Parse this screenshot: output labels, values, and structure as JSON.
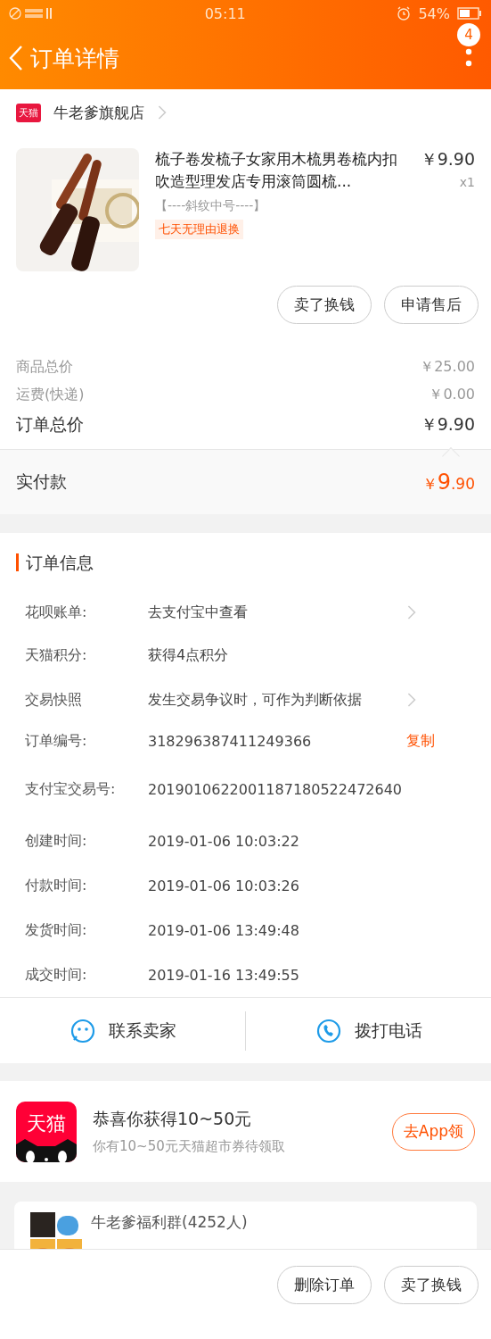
{
  "status_bar": {
    "time": "05:11",
    "battery": "54%"
  },
  "header": {
    "title": "订单详情",
    "badge": "4"
  },
  "store": {
    "badge": "天猫",
    "name": "牛老爹旗舰店"
  },
  "product": {
    "title": "梳子卷发梳子女家用木梳男卷梳内扣吹造型理发店专用滚筒圆梳...",
    "price": "￥9.90",
    "quantity": "x1",
    "variant": "【----斜纹中号----】",
    "tag": "七天无理由退换"
  },
  "product_actions": [
    "卖了换钱",
    "申请售后"
  ],
  "summary": [
    {
      "label": "商品总价",
      "value": "￥25.00",
      "kind": "minor"
    },
    {
      "label": "运费(快递)",
      "value": "￥0.00",
      "kind": "minor"
    },
    {
      "label": "订单总价",
      "value": "￥9.90",
      "kind": "total"
    }
  ],
  "paid": {
    "label": "实付款",
    "symbol": "￥",
    "integer": "9",
    "decimal": ".90"
  },
  "order_info": {
    "title": "订单信息",
    "rows": [
      {
        "label": "花呗账单:",
        "value": "去支付宝中查看",
        "kind": "link"
      },
      {
        "label": "天猫积分:",
        "value": "获得4点积分",
        "kind": "plain"
      },
      {
        "label": "交易快照",
        "value": "发生交易争议时，可作为判断依据",
        "kind": "link"
      },
      {
        "label": "订单编号:",
        "value": "318296387411249366",
        "kind": "copy",
        "action": "复制"
      },
      {
        "label": "支付宝交易号:",
        "value": "2019010622001187180522472640",
        "kind": "plain"
      },
      {
        "label": "创建时间:",
        "value": "2019-01-06 10:03:22",
        "kind": "plain"
      },
      {
        "label": "付款时间:",
        "value": "2019-01-06 10:03:26",
        "kind": "plain"
      },
      {
        "label": "发货时间:",
        "value": "2019-01-06 13:49:48",
        "kind": "plain"
      },
      {
        "label": "成交时间:",
        "value": "2019-01-16 13:49:55",
        "kind": "plain"
      }
    ]
  },
  "contact": [
    {
      "label": "联系卖家",
      "kind": "chat"
    },
    {
      "label": "拨打电话",
      "kind": "phone"
    }
  ],
  "promo": {
    "logo": "天猫",
    "title": "恭喜你获得10~50元",
    "subtitle": "你有10~50元天猫超市券待领取",
    "button": "去App领"
  },
  "group": {
    "name": "牛老爹福利群(4252人)"
  },
  "bottom_actions": [
    "删除订单",
    "卖了换钱"
  ]
}
